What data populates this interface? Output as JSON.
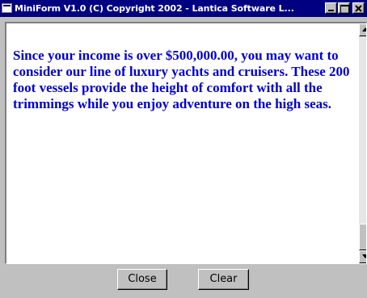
{
  "window": {
    "title": "MiniForm V1.0 (C) Copyright 2002 - Lantica Software L..."
  },
  "message": {
    "text": "Since your income is over $500,000.00, you may want to consider our line of luxury yachts and cruisers. These 200 foot vessels provide the height of comfort with all the trimmings while you enjoy adventure on the high seas.",
    "color": "#0000cc"
  },
  "buttons": {
    "close_label": "Close",
    "clear_label": "Clear"
  },
  "colors": {
    "titlebar": "#000080",
    "chrome": "#c0c0c0"
  }
}
